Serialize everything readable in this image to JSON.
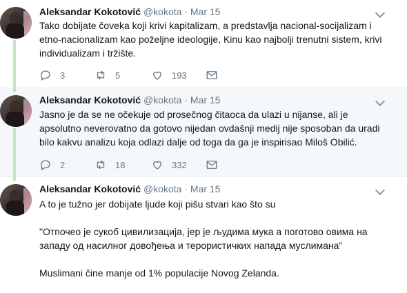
{
  "tweets": [
    {
      "name": "Aleksandar Kokotović",
      "handle": "@kokota",
      "sep": "·",
      "date": "Mar 15",
      "text": "Tako dobijate čoveka koji krivi kapitalizam, a predstavlja nacional-socijalizam i etno-nacionalizam kao poželjne ideologije, Kinu kao najbolji trenutni sistem, krivi individualizam i tržište.",
      "replies": "3",
      "retweets": "5",
      "likes": "193"
    },
    {
      "name": "Aleksandar Kokotović",
      "handle": "@kokota",
      "sep": "·",
      "date": "Mar 15",
      "text": "Jasno je da se ne očekuje od prosečnog čitaoca da ulazi u nijanse, ali je apsolutno neverovatno da gotovo nijedan ovdašnji medij nije sposoban da uradi bilo kakvu analizu koja odlazi dalje od toga da ga je inspirisao Miloš Obilić.",
      "replies": "2",
      "retweets": "18",
      "likes": "332"
    },
    {
      "name": "Aleksandar Kokotović",
      "handle": "@kokota",
      "sep": "·",
      "date": "Mar 15",
      "text1": "A to je tužno jer dobijate ljude koji pišu stvari kao što su",
      "text2": "\"Отпочео је сукоб цивилизација, јер је људима мука а поготово овима на западу од насилног довођења и терористичких напада муслимана\"",
      "text3": "Muslimani čine manje od 1% populacije Novog Zelanda."
    }
  ]
}
